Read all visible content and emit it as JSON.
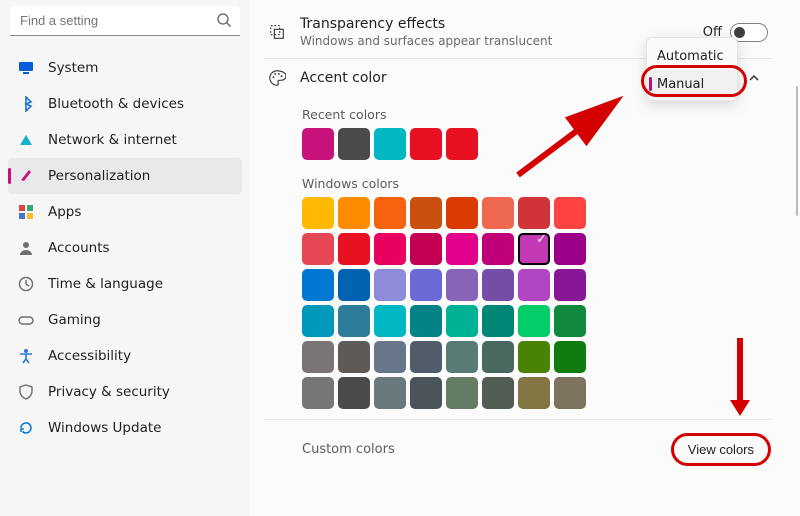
{
  "search": {
    "placeholder": "Find a setting"
  },
  "nav": [
    {
      "label": "System",
      "icon": "monitor",
      "color": "#0a5cd8"
    },
    {
      "label": "Bluetooth & devices",
      "icon": "bluetooth",
      "color": "#1a77d1"
    },
    {
      "label": "Network & internet",
      "icon": "wifi",
      "color": "#16b0c8"
    },
    {
      "label": "Personalization",
      "icon": "brush",
      "color": "#c6127a",
      "selected": true
    },
    {
      "label": "Apps",
      "icon": "apps",
      "color": "#5b5b5b"
    },
    {
      "label": "Accounts",
      "icon": "user",
      "color": "#6e6e6e"
    },
    {
      "label": "Time & language",
      "icon": "clock",
      "color": "#6e6e6e"
    },
    {
      "label": "Gaming",
      "icon": "gaming",
      "color": "#6e6e6e"
    },
    {
      "label": "Accessibility",
      "icon": "accessibility",
      "color": "#2b78d8"
    },
    {
      "label": "Privacy & security",
      "icon": "shield",
      "color": "#6e6e6e"
    },
    {
      "label": "Windows Update",
      "icon": "update",
      "color": "#0a7dd8"
    }
  ],
  "transparency": {
    "title": "Transparency effects",
    "subtitle": "Windows and surfaces appear translucent",
    "state": "Off"
  },
  "accent": {
    "title": "Accent color",
    "options": [
      "Automatic",
      "Manual"
    ],
    "selected": "Manual"
  },
  "colors": {
    "recent_label": "Recent colors",
    "recent": [
      "#c6127a",
      "#4a4a4a",
      "#00b7c3",
      "#e81123",
      "#e81123"
    ],
    "windows_label": "Windows colors",
    "windows": [
      "#ffb900",
      "#ff8c00",
      "#f7630c",
      "#ca5010",
      "#da3b01",
      "#ef6950",
      "#d13438",
      "#ff4343",
      "#e74856",
      "#e81123",
      "#ea005e",
      "#c30052",
      "#e3008c",
      "#bf0077",
      "#c239b3",
      "#9a0089",
      "#0078d4",
      "#0063b1",
      "#8e8cd8",
      "#6b69d6",
      "#8764b8",
      "#744da9",
      "#b146c2",
      "#881798",
      "#0099bc",
      "#2d7d9a",
      "#00b7c3",
      "#038387",
      "#00b294",
      "#018574",
      "#00cc6a",
      "#10893e",
      "#7a7574",
      "#5d5a58",
      "#68768a",
      "#515c6b",
      "#567c73",
      "#486860",
      "#498205",
      "#107c10",
      "#767676",
      "#4c4a48",
      "#69797e",
      "#4a5459",
      "#647c64",
      "#525e54",
      "#847545",
      "#7e735f"
    ],
    "windows_selected_index": 14
  },
  "custom": {
    "label": "Custom colors",
    "button": "View colors"
  }
}
